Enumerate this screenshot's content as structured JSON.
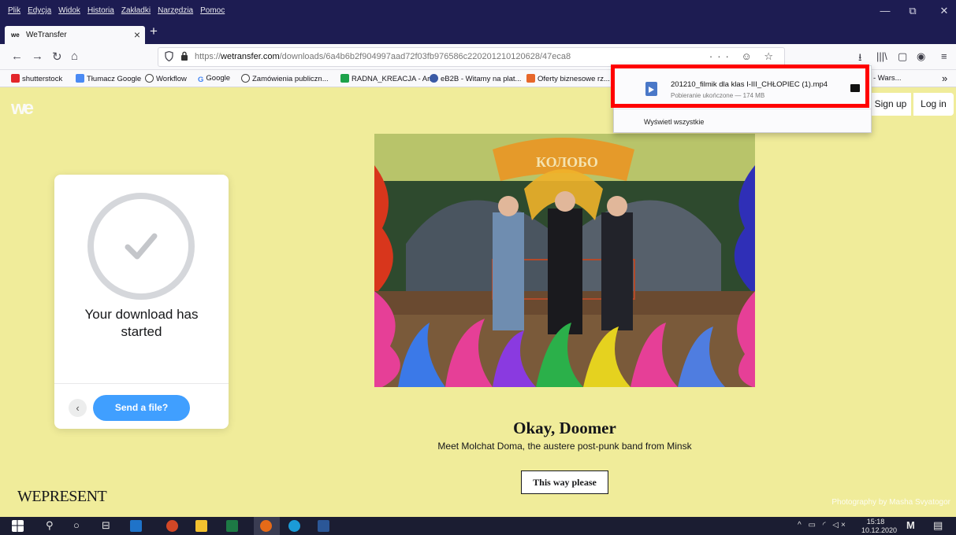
{
  "window": {
    "menu": [
      "Plik",
      "Edycja",
      "Widok",
      "Historia",
      "Zakładki",
      "Narzędzia",
      "Pomoc"
    ],
    "controls": {
      "minimize": "—",
      "restore": "⧉",
      "close": "✕"
    }
  },
  "tab": {
    "favicon": "we",
    "title": "WeTransfer",
    "close": "×",
    "new_tab": "+"
  },
  "nav": {
    "back": "←",
    "forward": "→",
    "reload": "↻",
    "home": "⌂",
    "url_prefix": "https://",
    "url_host": "wetransfer.com",
    "url_path": "/downloads/6a4b6b2f904997aad72f03fb976586c220201210120628/47eca8",
    "url_tools": "··· ☺ ☆",
    "downloads_icon": "⭳",
    "library_icon": "|||\\",
    "sidebar_icon": "▢",
    "account_icon": "◉",
    "menu_icon": "≡"
  },
  "bookmarks": [
    {
      "label": "shutterstock",
      "color": "#e3262b"
    },
    {
      "label": "Tłumacz Google",
      "color": "#4a8af4"
    },
    {
      "label": "Workflow",
      "color": "#444444"
    },
    {
      "label": "Google",
      "color": "#4285f4"
    },
    {
      "label": "Zamówienia publiczn...",
      "color": "#444444"
    },
    {
      "label": "RADNA_KREACJA - Ar...",
      "color": "#1da24a"
    },
    {
      "label": "eB2B - Witamy na plat...",
      "color": "#3b5aa5"
    },
    {
      "label": "Oferty biznesowe rz...",
      "color": "#e7672a"
    },
    {
      "label": "- Wars...",
      "color": "#777777"
    }
  ],
  "bookmarks_overflow": "»",
  "downloads_panel": {
    "file_name": "201210_filmik dla klas I-III_CHŁOPIEC (1).mp4",
    "status": "Pobieranie ukończone — 174 MB",
    "show_all": "Wyświetl wszystkie"
  },
  "page": {
    "logo": "we",
    "signup": "Sign up",
    "login": "Log in",
    "card": {
      "message": "Your download has started",
      "back": "‹",
      "send": "Send a file?"
    },
    "feature": {
      "title": "Okay, Doomer",
      "subtitle": "Meet Molchat Doma, the austere post-punk band from Minsk",
      "cta": "This way please"
    },
    "brand": "WEPRESENT",
    "credit": "Photography by Masha Svyatogor",
    "art_sign": "КОЛОБО"
  },
  "taskbar": {
    "start_icon": "windows-icon",
    "clock_time": "15:18",
    "clock_date": "10.12.2020",
    "tray": "^ ▭ ◜ ◁×"
  },
  "colors": {
    "page_bg": "#f0ec9a",
    "chrome_dark": "#1d1c52",
    "send_button": "#409fff",
    "highlight": "#ff0000"
  }
}
